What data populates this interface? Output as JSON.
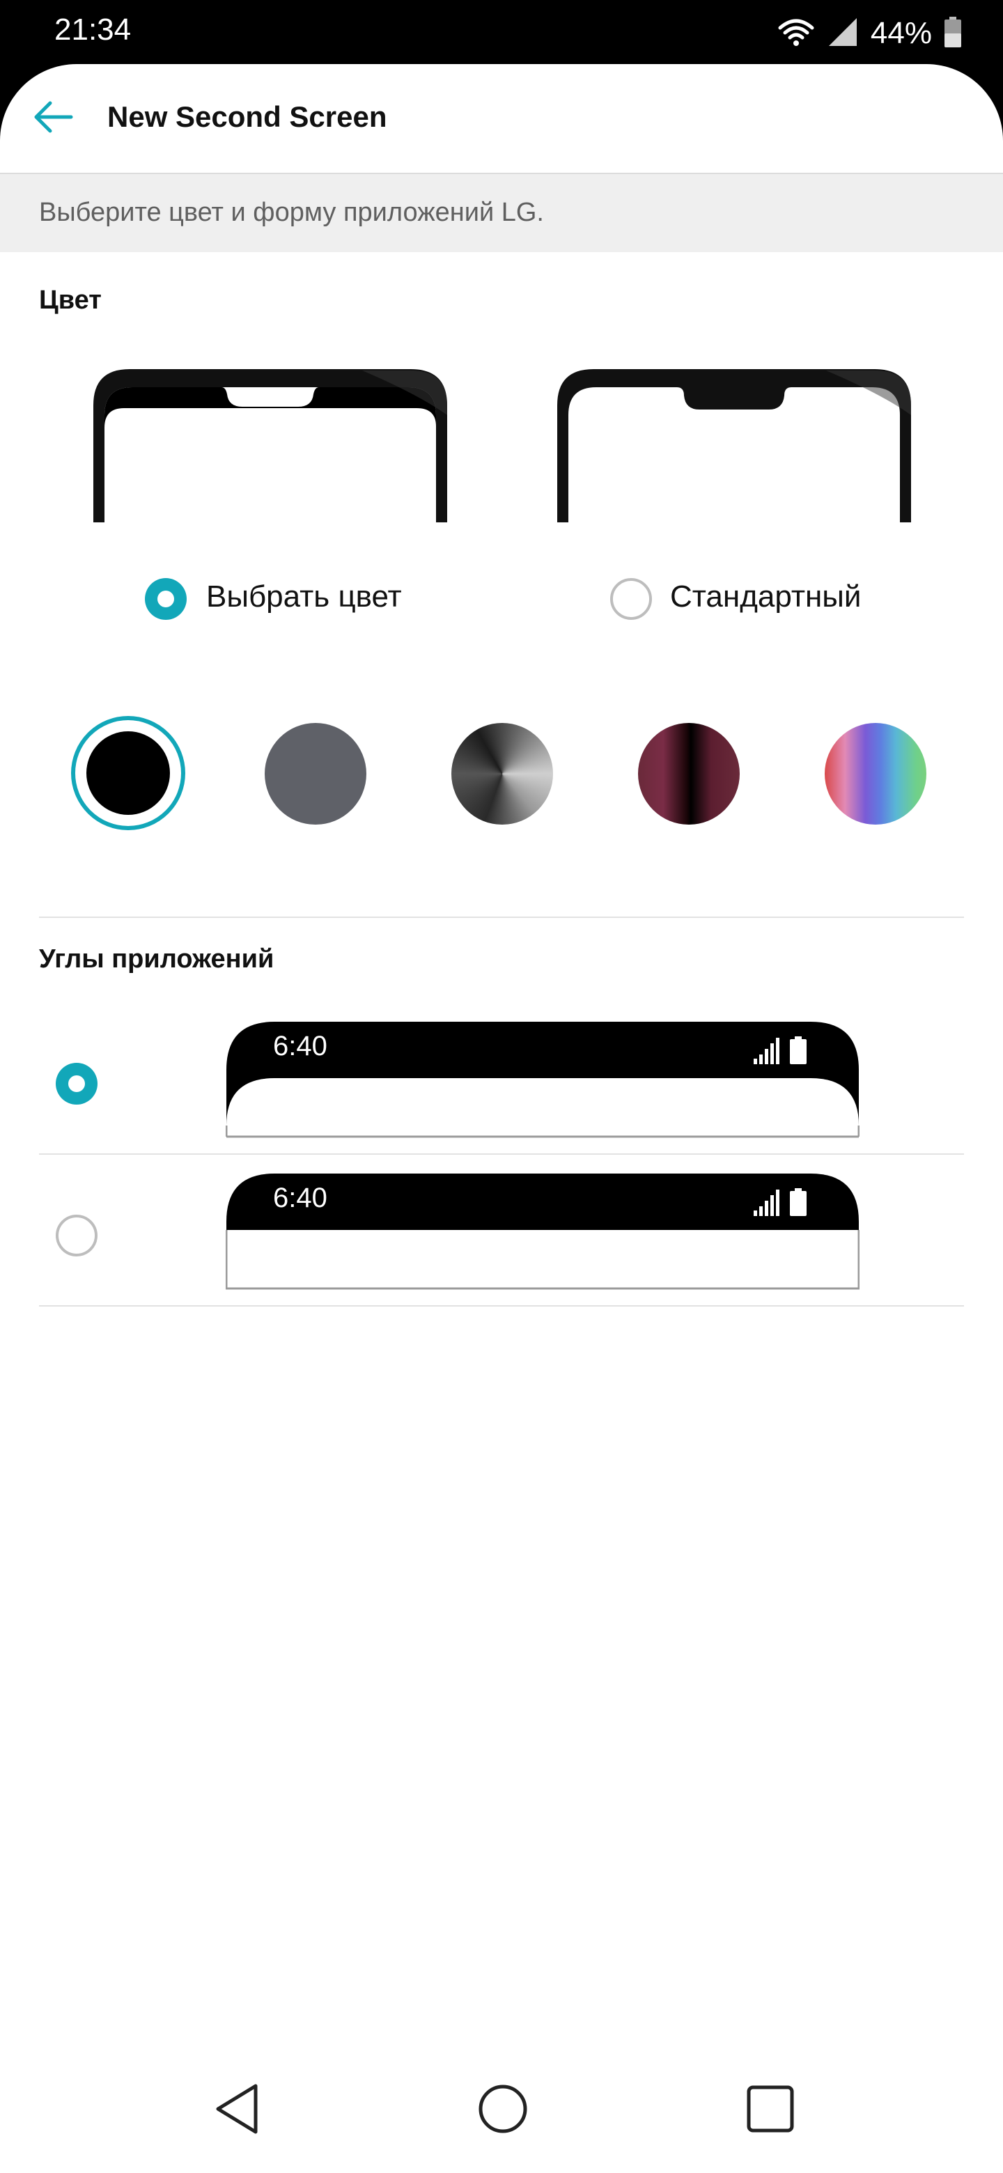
{
  "status_bar": {
    "time": "21:34",
    "battery_percent": "44%",
    "icons": [
      "wifi-icon",
      "signal-icon",
      "battery-icon"
    ]
  },
  "header": {
    "title": "New Second Screen",
    "back_icon": "arrow-left-icon",
    "accent_color": "#12a7b9"
  },
  "description": "Выберите цвет и форму приложений LG.",
  "color_section": {
    "title": "Цвет",
    "options": [
      {
        "label": "Выбрать цвет",
        "selected": true
      },
      {
        "label": "Стандартный",
        "selected": false
      }
    ],
    "swatches": [
      {
        "name": "black",
        "selected": true
      },
      {
        "name": "gray",
        "selected": false
      },
      {
        "name": "monochrome",
        "selected": false
      },
      {
        "name": "wine",
        "selected": false
      },
      {
        "name": "rainbow",
        "selected": false
      }
    ]
  },
  "corners_section": {
    "title": "Углы приложений",
    "options": [
      {
        "style": "rounded",
        "selected": true,
        "preview_time": "6:40"
      },
      {
        "style": "square",
        "selected": false,
        "preview_time": "6:40"
      }
    ]
  },
  "nav_bar": {
    "buttons": [
      "back-triangle-icon",
      "home-circle-icon",
      "recents-square-icon"
    ]
  }
}
